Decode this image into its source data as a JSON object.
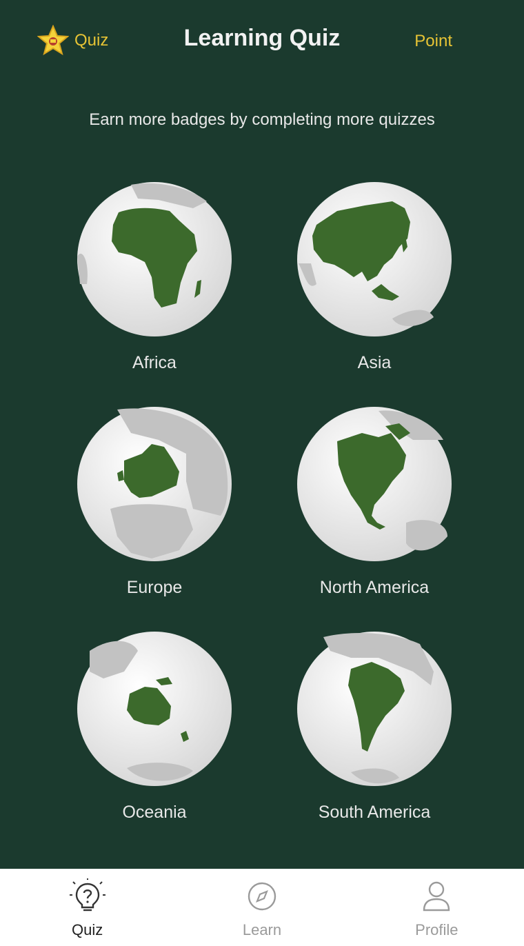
{
  "header": {
    "quiz_label": "Quiz",
    "title": "Learning Quiz",
    "point_label": "Point"
  },
  "subtitle": "Earn more badges by completing more quizzes",
  "continents": [
    {
      "label": "Africa",
      "icon": "globe-africa-icon"
    },
    {
      "label": "Asia",
      "icon": "globe-asia-icon"
    },
    {
      "label": "Europe",
      "icon": "globe-europe-icon"
    },
    {
      "label": "North America",
      "icon": "globe-north-america-icon"
    },
    {
      "label": "Oceania",
      "icon": "globe-oceania-icon"
    },
    {
      "label": "South America",
      "icon": "globe-south-america-icon"
    }
  ],
  "nav": {
    "items": [
      {
        "label": "Quiz",
        "icon": "lightbulb-question-icon",
        "active": true
      },
      {
        "label": "Learn",
        "icon": "compass-icon",
        "active": false
      },
      {
        "label": "Profile",
        "icon": "user-icon",
        "active": false
      }
    ]
  },
  "colors": {
    "background": "#1b3a2e",
    "accent": "#e6c335",
    "land_highlight": "#3c6a2c",
    "globe": "#e9e9e9",
    "land_other": "#b8b8b8"
  }
}
